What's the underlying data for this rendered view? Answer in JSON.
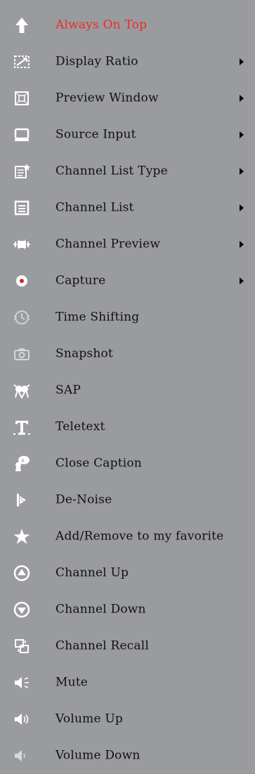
{
  "colors": {
    "background": "#9a9b9e",
    "text": "#111111",
    "active_text": "#ee2a2a",
    "icon": "#ffffff"
  },
  "menu": {
    "items": [
      {
        "label": "Always On Top",
        "icon": "up-arrow-icon",
        "submenu": false,
        "active": true
      },
      {
        "label": "Display Ratio",
        "icon": "display-ratio-icon",
        "submenu": true
      },
      {
        "label": "Preview Window",
        "icon": "preview-window-icon",
        "submenu": true
      },
      {
        "label": "Source Input",
        "icon": "monitor-icon",
        "submenu": true
      },
      {
        "label": "Channel List Type",
        "icon": "list-type-icon",
        "submenu": true
      },
      {
        "label": "Channel List",
        "icon": "list-icon",
        "submenu": true
      },
      {
        "label": "Channel Preview",
        "icon": "channel-preview-icon",
        "submenu": true
      },
      {
        "label": "Capture",
        "icon": "record-dot-icon",
        "submenu": true
      },
      {
        "label": "Time Shifting",
        "icon": "time-shift-icon",
        "submenu": false
      },
      {
        "label": "Snapshot",
        "icon": "camera-icon",
        "submenu": false
      },
      {
        "label": "SAP",
        "icon": "sap-icon",
        "submenu": false
      },
      {
        "label": "Teletext",
        "icon": "teletext-icon",
        "submenu": false
      },
      {
        "label": "Close Caption",
        "icon": "caption-bubble-icon",
        "submenu": false
      },
      {
        "label": "De-Noise",
        "icon": "de-noise-icon",
        "submenu": false
      },
      {
        "label": "Add/Remove to my favorite",
        "icon": "star-icon",
        "submenu": false
      },
      {
        "label": "Channel Up",
        "icon": "circle-up-icon",
        "submenu": false
      },
      {
        "label": "Channel Down",
        "icon": "circle-down-icon",
        "submenu": false
      },
      {
        "label": "Channel Recall",
        "icon": "channel-recall-icon",
        "submenu": false
      },
      {
        "label": "Mute",
        "icon": "mute-speaker-icon",
        "submenu": false
      },
      {
        "label": "Volume Up",
        "icon": "volume-up-icon",
        "submenu": false
      },
      {
        "label": "Volume Down",
        "icon": "volume-down-icon",
        "submenu": false
      }
    ]
  }
}
